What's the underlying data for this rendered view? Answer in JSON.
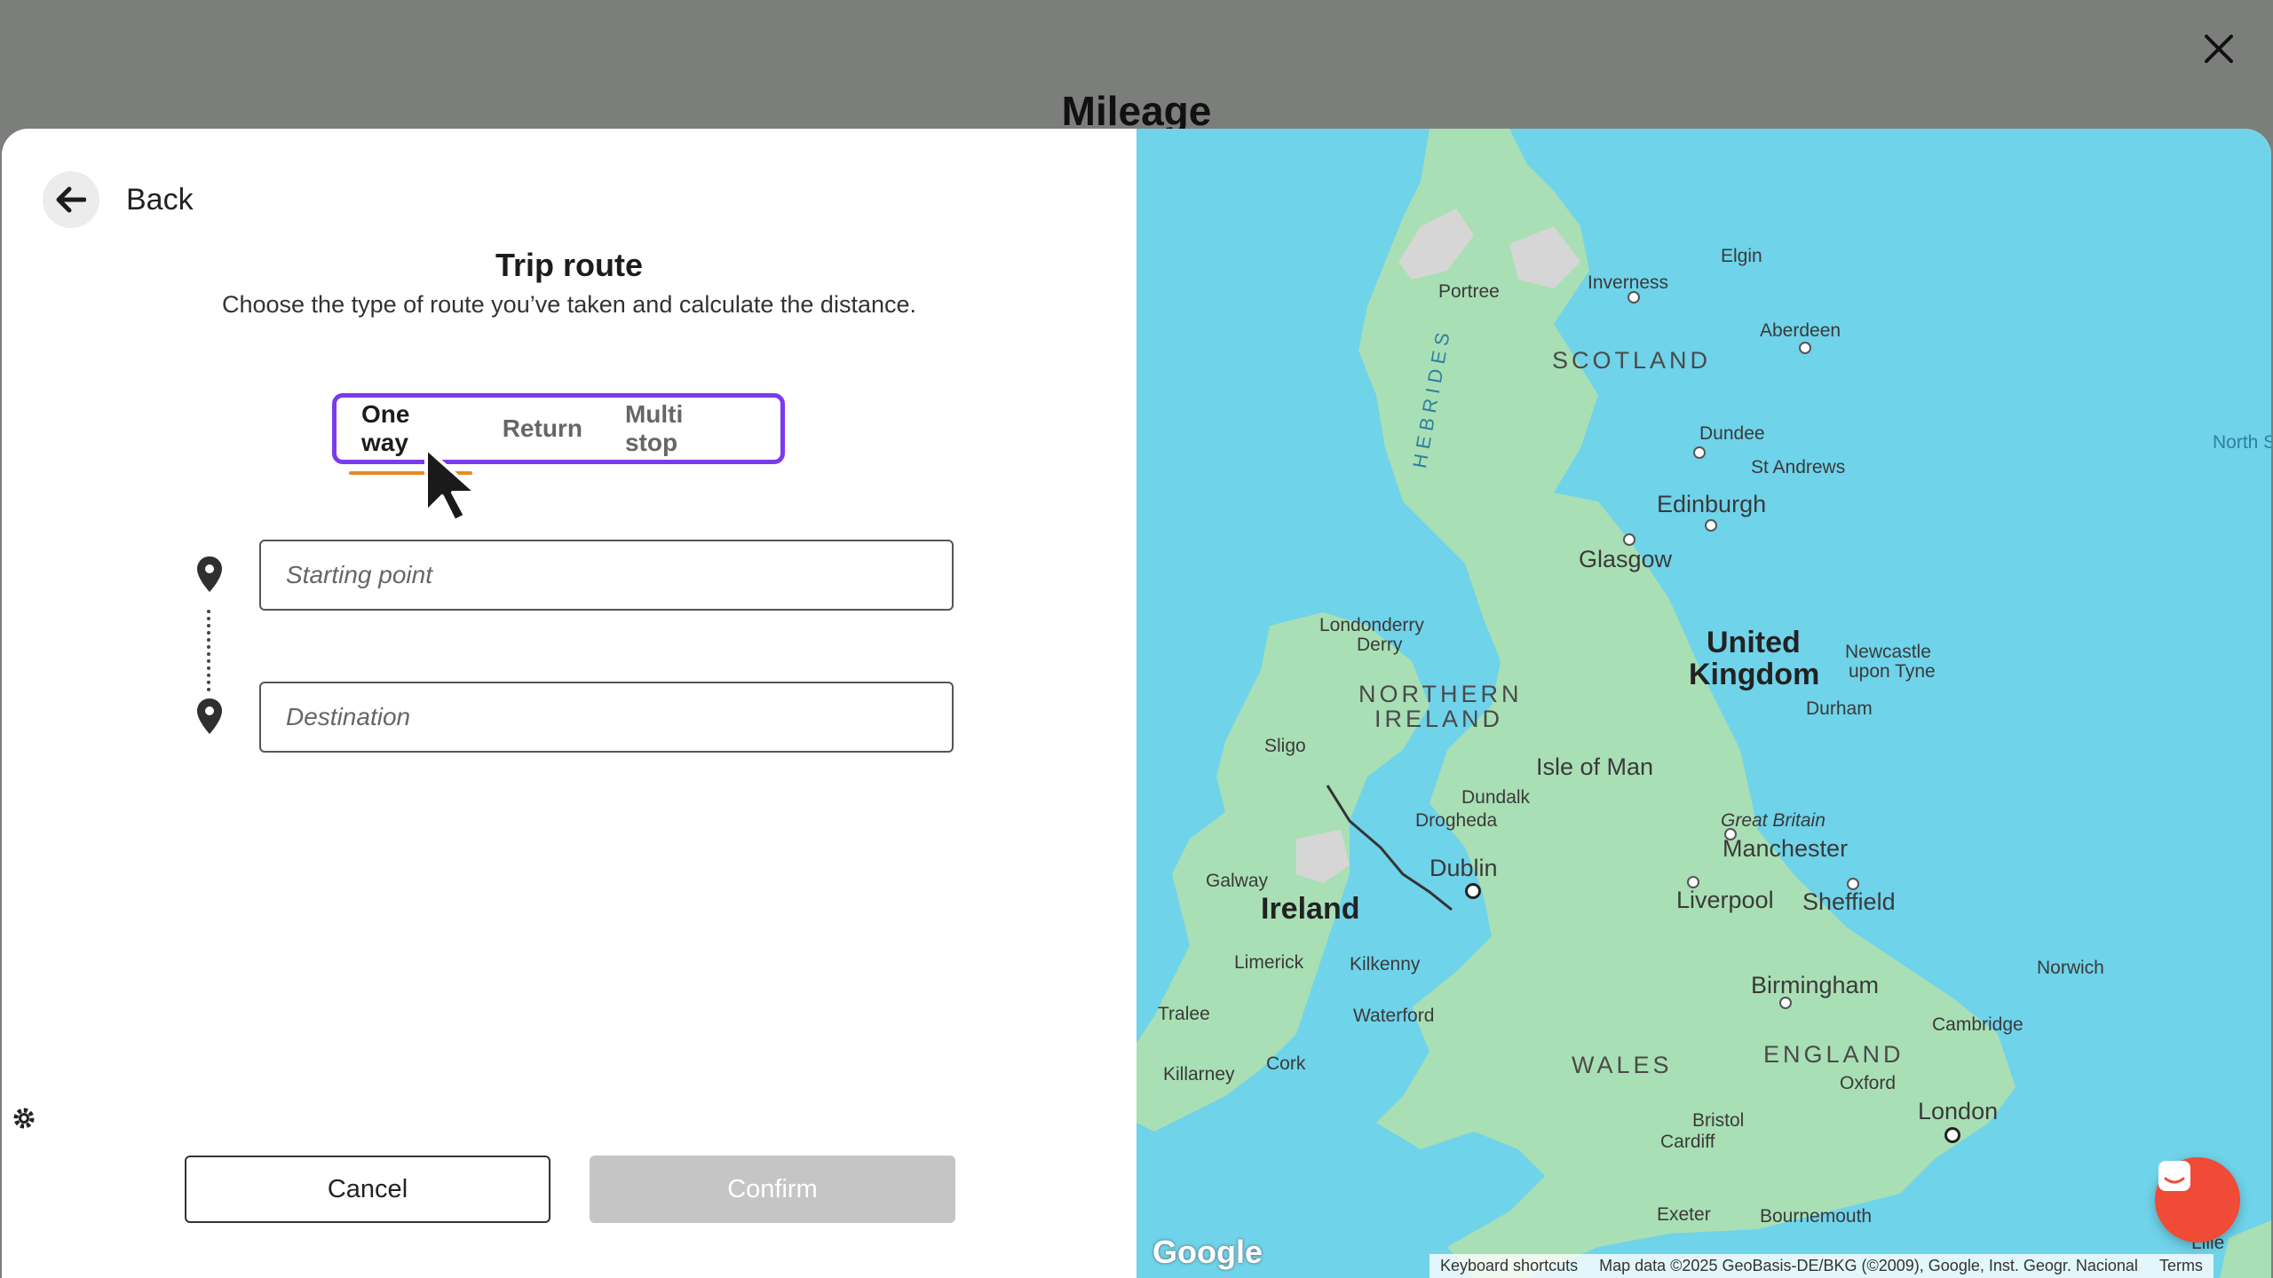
{
  "backdrop": {
    "title": "Mileage"
  },
  "back": {
    "label": "Back"
  },
  "trip": {
    "title": "Trip route",
    "subtitle": "Choose the type of route you’ve taken and calculate the distance."
  },
  "tabs": [
    {
      "label": "One way",
      "active": true
    },
    {
      "label": "Return",
      "active": false
    },
    {
      "label": "Multi stop",
      "active": false
    }
  ],
  "inputs": {
    "start": {
      "placeholder": "Starting point",
      "value": ""
    },
    "destination": {
      "placeholder": "Destination",
      "value": ""
    }
  },
  "buttons": {
    "cancel": "Cancel",
    "confirm": "Confirm"
  },
  "colors": {
    "tab_outline": "#7c3aed",
    "tab_underline": "#ea8a1e",
    "confirm_disabled": "#c5c5c5",
    "water": "#6fd3ea",
    "land": "#a9dfb4",
    "chat": "#ef4b36"
  },
  "map": {
    "labels": {
      "elgin": "Elgin",
      "portree": "Portree",
      "inverness": "Inverness",
      "aberdeen": "Aberdeen",
      "hebrides": "HEBRIDES",
      "scotland": "SCOTLAND",
      "dundee": "Dundee",
      "st_andrews": "St Andrews",
      "north_sea": "North S",
      "edinburgh": "Edinburgh",
      "glasgow": "Glasgow",
      "londonderry": "Londonderry",
      "derry": "Derry",
      "northern": "NORTHERN",
      "ireland_region": "IRELAND",
      "united": "United",
      "kingdom": "Kingdom",
      "newcastle": "Newcastle",
      "upon_tyne": "upon Tyne",
      "durham": "Durham",
      "sligo": "Sligo",
      "isle_of_man": "Isle of Man",
      "dundalk": "Dundalk",
      "drogheda": "Drogheda",
      "great_britain": "Great Britain",
      "manchester": "Manchester",
      "dublin": "Dublin",
      "galway": "Galway",
      "ireland": "Ireland",
      "liverpool": "Liverpool",
      "sheffield": "Sheffield",
      "limerick": "Limerick",
      "kilkenny": "Kilkenny",
      "norwich": "Norwich",
      "birmingham": "Birmingham",
      "tralee": "Tralee",
      "waterford": "Waterford",
      "cambridge": "Cambridge",
      "england": "ENGLAND",
      "killarney": "Killarney",
      "cork": "Cork",
      "wales": "WALES",
      "oxford": "Oxford",
      "london": "London",
      "bristol": "Bristol",
      "cardiff": "Cardiff",
      "exeter": "Exeter",
      "bournemouth": "Bournemouth",
      "lille": "Lille"
    },
    "google": "Google",
    "keyboard_shortcuts": "Keyboard shortcuts",
    "map_data": "Map data ©2025 GeoBasis-DE/BKG (©2009), Google, Inst. Geogr. Nacional",
    "terms": "Terms"
  }
}
